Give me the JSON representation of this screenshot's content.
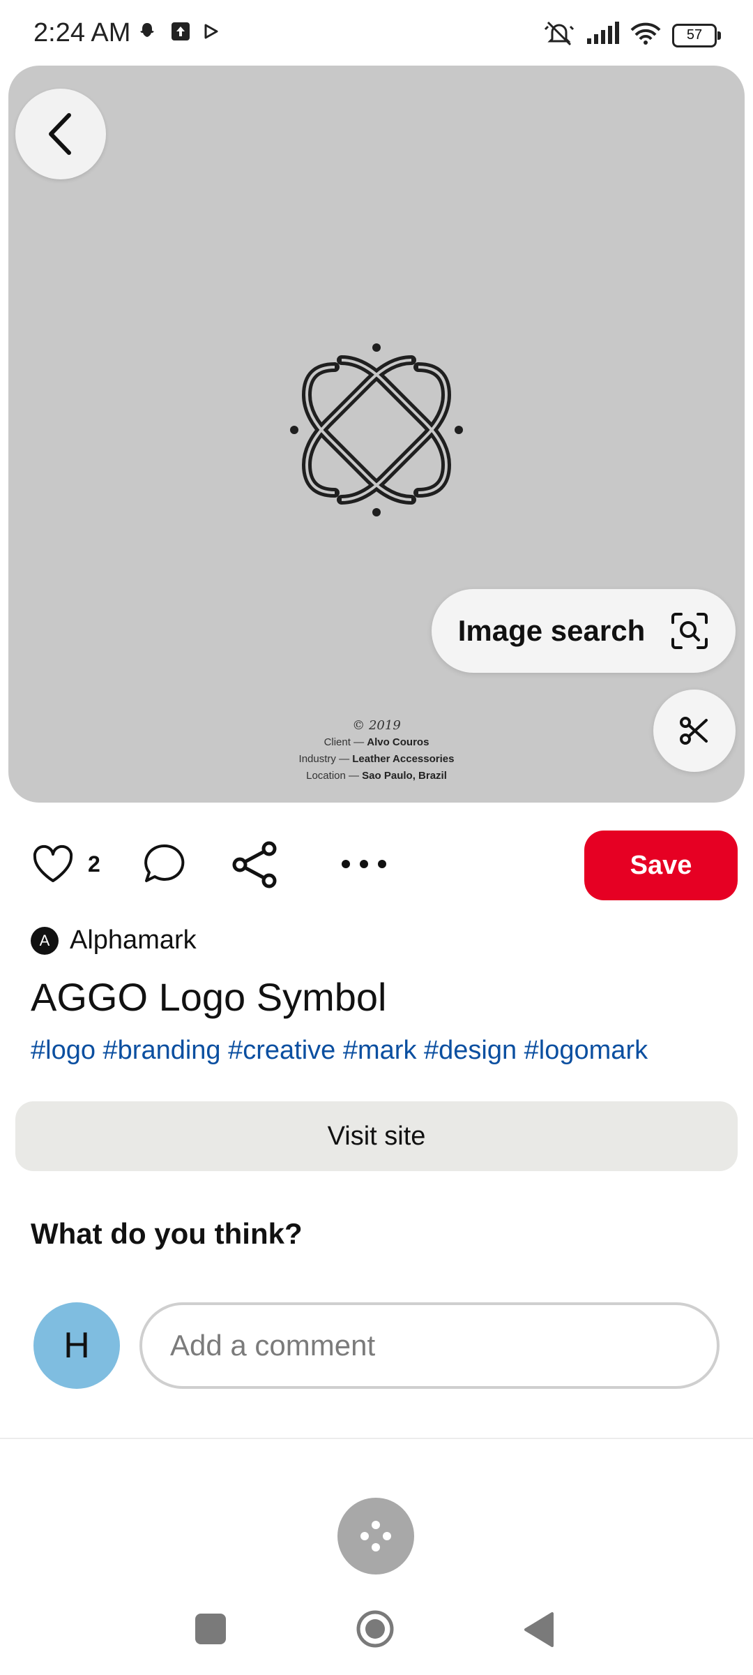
{
  "status_bar": {
    "time": "2:24 AM",
    "battery": "57",
    "left_icons": [
      "snapchat-icon",
      "upload-icon",
      "play-store-icon"
    ],
    "right_icons": [
      "mute-icon",
      "signal-icon",
      "wifi-icon",
      "battery-icon"
    ]
  },
  "pin": {
    "image_credits": {
      "year": "© 2019",
      "client_label": "Client — ",
      "client": "Alvo Couros",
      "industry_label": "Industry — ",
      "industry": "Leather Accessories",
      "location_label": "Location — ",
      "location": "Sao Paulo, Brazil"
    },
    "image_search_label": "Image search",
    "like_count": "2",
    "save_label": "Save",
    "creator": {
      "avatar_letter": "A",
      "name": "Alphamark"
    },
    "title": "AGGO Logo Symbol",
    "hashtags": "#logo #branding #creative #mark #design #logomark",
    "visit_site_label": "Visit site"
  },
  "comments": {
    "heading": "What do you think?",
    "user_initial": "H",
    "placeholder": "Add a comment"
  },
  "colors": {
    "save": "#e60023",
    "hashtag": "#0b4fa0",
    "avatar": "#7fbde0",
    "image_bg": "#c8c8c8"
  }
}
